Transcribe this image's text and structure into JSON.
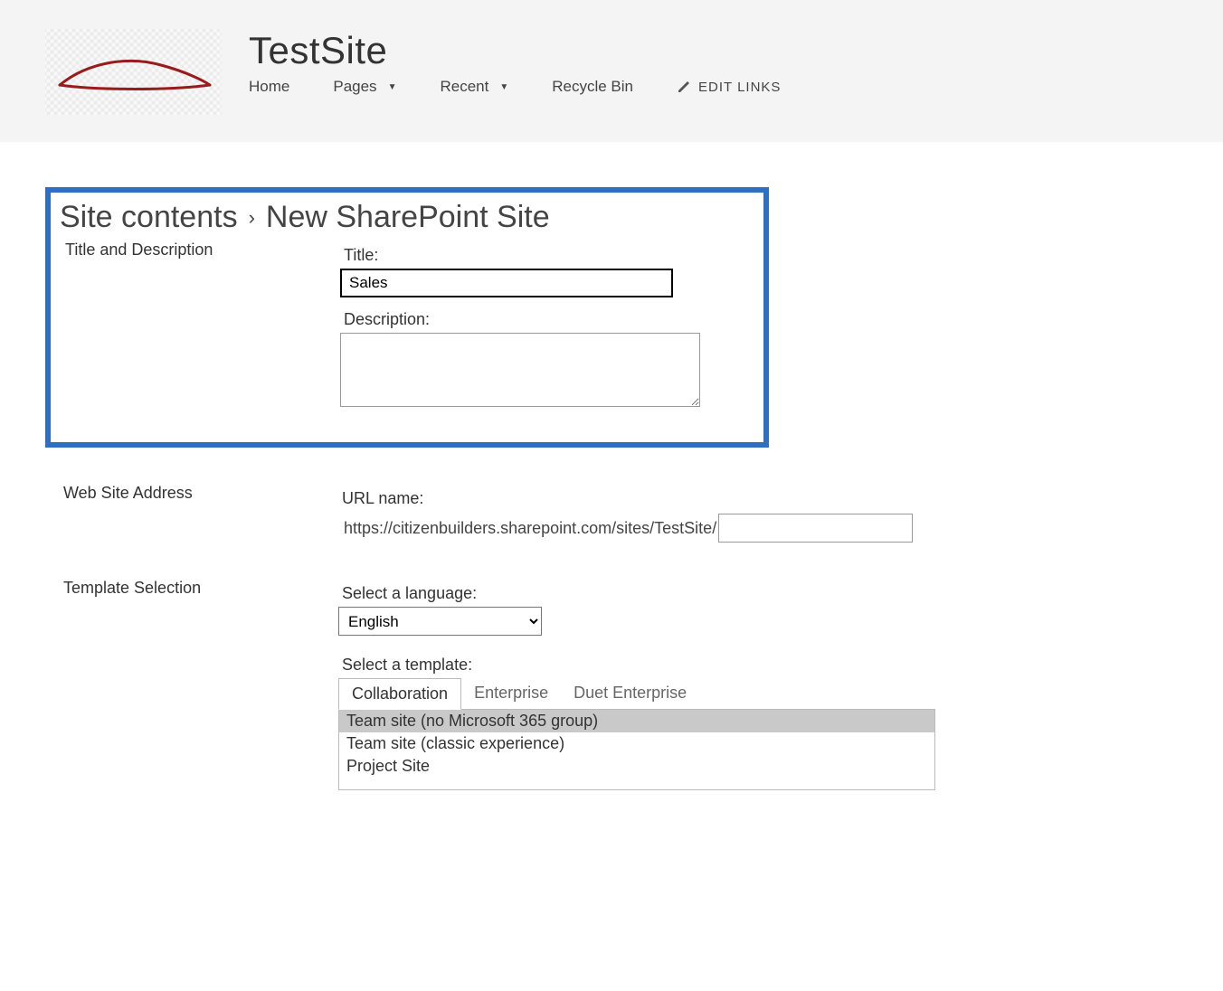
{
  "header": {
    "site_title": "TestSite",
    "nav": {
      "home": "Home",
      "pages": "Pages",
      "recent": "Recent",
      "recycle_bin": "Recycle Bin",
      "edit_links": "EDIT LINKS"
    }
  },
  "breadcrumb": {
    "part1": "Site contents",
    "part2": "New SharePoint Site"
  },
  "sections": {
    "title_desc": {
      "heading": "Title and Description",
      "title_label": "Title:",
      "title_value": "Sales",
      "desc_label": "Description:",
      "desc_value": ""
    },
    "web_address": {
      "heading": "Web Site Address",
      "url_label": "URL name:",
      "url_prefix": "https://citizenbuilders.sharepoint.com/sites/TestSite/",
      "url_value": ""
    },
    "template": {
      "heading": "Template Selection",
      "lang_label": "Select a language:",
      "lang_value": "English",
      "template_label": "Select a template:",
      "tabs": {
        "collaboration": "Collaboration",
        "enterprise": "Enterprise",
        "duet": "Duet Enterprise"
      },
      "options": [
        "Team site (no Microsoft 365 group)",
        "Team site (classic experience)",
        "Project Site"
      ]
    }
  }
}
